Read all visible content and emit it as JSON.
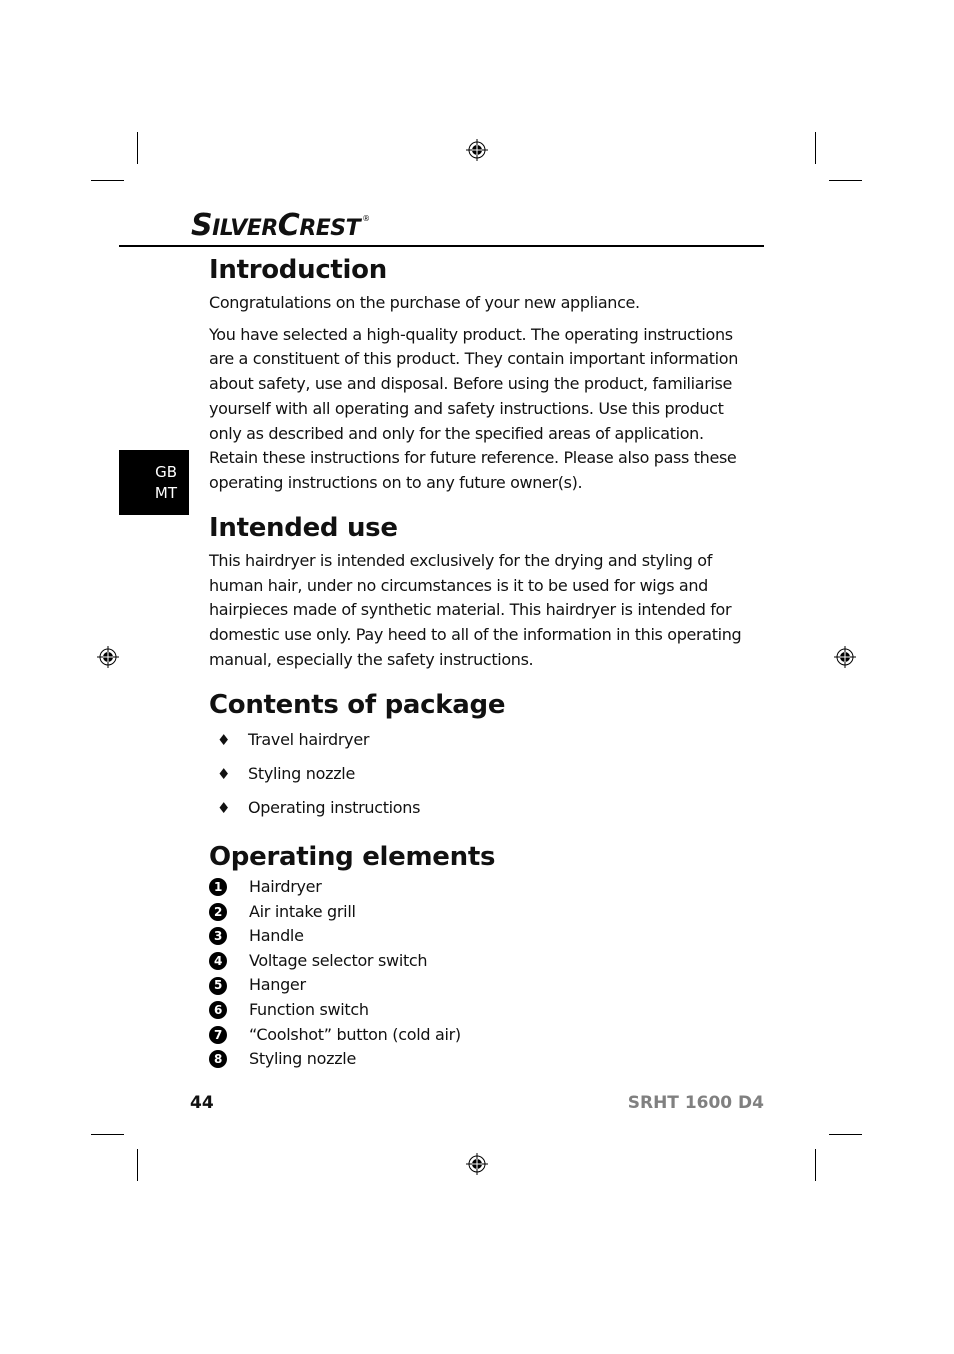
{
  "brand": {
    "logo_part1_big": "S",
    "logo_part1_small": "ILVER",
    "logo_part2_big": "C",
    "logo_part2_small": "REST",
    "registered": "®"
  },
  "language_tab": {
    "line1": "GB",
    "line2": "MT"
  },
  "sections": {
    "introduction": {
      "title": "Introduction",
      "paragraphs": [
        "Congratulations on the purchase of your new appliance.",
        "You have selected a high-quality product. The operating instructions are a constituent of this product. They contain important information about safety, use and disposal. Before using the product, familiarise yourself with all operating and safety instructions. Use this product only as described and only for the specified areas of application. Retain these instructions for future reference. Please also pass these operating instructions on to any future owner(s)."
      ]
    },
    "intended_use": {
      "title": "Intended use",
      "paragraph": "This hairdryer is intended exclusively for the drying and styling of human hair, under no circumstances is it to be used for wigs and hairpieces made of synthetic material. This hairdryer is intended for domestic use only. Pay heed to all of the information in this operating manual, especially the safety instructions."
    },
    "contents": {
      "title": "Contents of package",
      "bullet_glyph": "♦",
      "items": [
        "Travel hairdryer",
        "Styling nozzle",
        "Operating instructions"
      ]
    },
    "operating_elements": {
      "title": "Operating elements",
      "items": [
        {
          "num": "1",
          "label": "Hairdryer"
        },
        {
          "num": "2",
          "label": "Air intake grill"
        },
        {
          "num": "3",
          "label": "Handle"
        },
        {
          "num": "4",
          "label": "Voltage selector switch"
        },
        {
          "num": "5",
          "label": "Hanger"
        },
        {
          "num": "6",
          "label": "Function switch"
        },
        {
          "num": "7",
          "label": "“Coolshot” button (cold air)"
        },
        {
          "num": "8",
          "label": "Styling nozzle"
        }
      ]
    }
  },
  "footer": {
    "page_number": "44",
    "model": "SRHT 1600 D4",
    "model_color": "#808080"
  },
  "icons": {
    "registration_mark": "registration-crosshair-icon"
  }
}
